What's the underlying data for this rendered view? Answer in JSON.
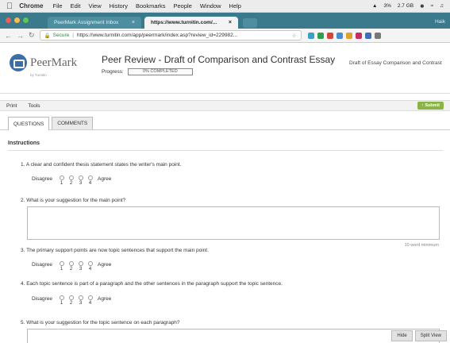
{
  "menubar": {
    "app": "Chrome",
    "items": [
      "File",
      "Edit",
      "View",
      "History",
      "Bookmarks",
      "People",
      "Window",
      "Help"
    ],
    "battery": "3%",
    "storage": "2.7 GB"
  },
  "browser": {
    "tabs": [
      {
        "label": "PeerMark Assignment Inbox"
      },
      {
        "label": "https://www.turnitin.com/..."
      }
    ],
    "profile": "Haik",
    "url_secure": "Secure",
    "url": "https://www.turnitin.com/app/peermark/index.asp?review_id=229982..."
  },
  "header": {
    "logo": "PeerMark",
    "logo_sub": "by Turnitin",
    "title": "Peer Review - Draft of Comparison and Contrast Essay",
    "progress_label": "Progress:",
    "progress_text": "0% COMPLETED",
    "doc_title": "Draft of Essay Comparison and Contrast"
  },
  "toolbar": {
    "print": "Print",
    "tools": "Tools",
    "submit": "Submit"
  },
  "tabs": {
    "questions": "QUESTIONS",
    "comments": "COMMENTS"
  },
  "content": {
    "instructions": "Instructions",
    "q1": "1. A clear and confident thesis statement states the writer's main point.",
    "q2": "2. What is your suggestion for the main point?",
    "q3": "3. The primary support points are now topic sentences that support the main point.",
    "q4": "4. Each topic sentence is part of a paragraph and the other sentences in the paragraph support the topic sentence.",
    "q5": "5. What is your suggestion for the topic sentence on each paragraph?",
    "disagree": "Disagree",
    "agree": "Agree",
    "scale_numbers": [
      "1",
      "2",
      "3",
      "4"
    ],
    "word_minimum": "10 word minimum"
  },
  "buttons": {
    "hide": "Hide",
    "split_view": "Split View"
  }
}
